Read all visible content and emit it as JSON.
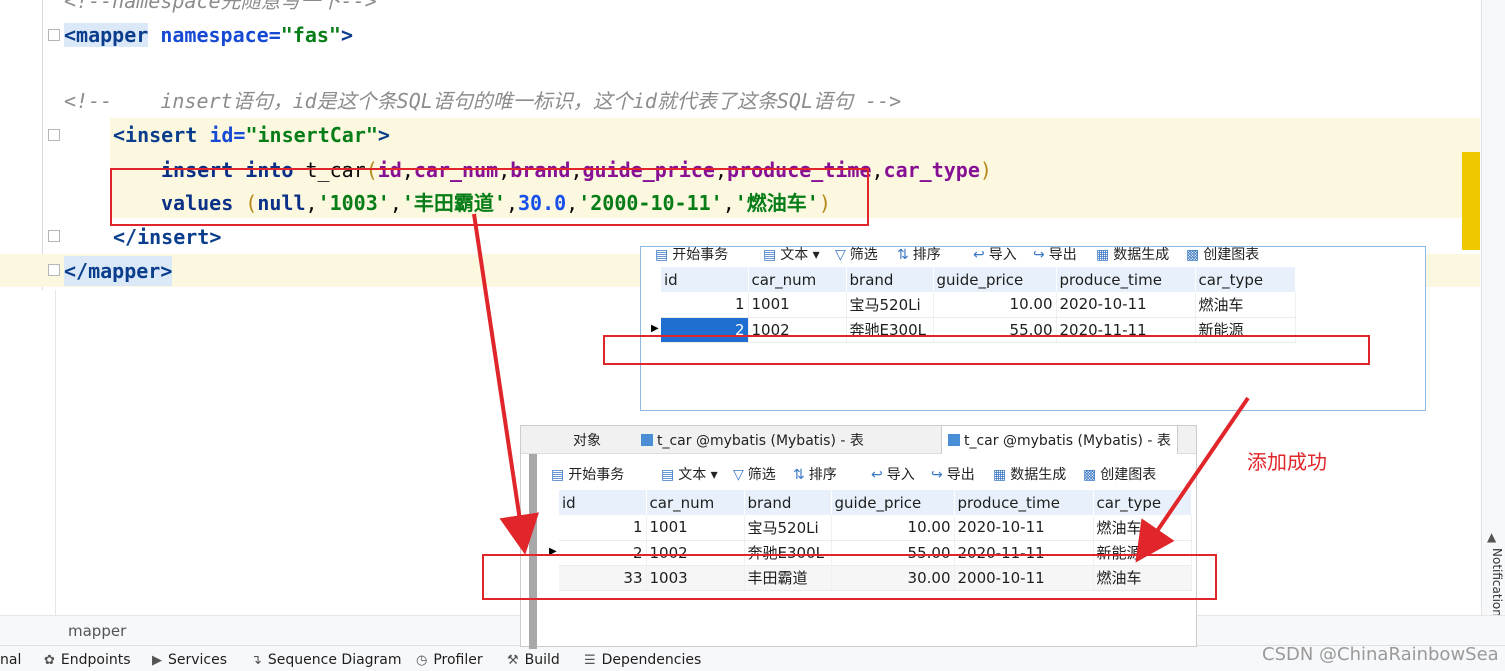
{
  "editor": {
    "lines": {
      "top_comment": "<!--namespace先随意写一下-->",
      "mapper_open_tag": "<mapper",
      "mapper_attr": "namespace=",
      "mapper_attr_value": "\"fas\"",
      "mapper_close_bracket": ">",
      "comment": "<!--    insert语句，id是这个条SQL语句的唯一标识，这个id就代表了这条SQL语句 -->",
      "insert_open": "<insert",
      "insert_attr": "id=",
      "insert_attr_value": "\"insertCar\"",
      "insert_bracket": ">",
      "sql_kw": "insert into",
      "sql_table": " t_car",
      "sql_cols": [
        "id",
        "car_num",
        "brand",
        "guide_price",
        "produce_time",
        "car_type"
      ],
      "values_kw": "values",
      "values_null": "null",
      "values_strs": [
        "'1003'",
        "'丰田霸道'"
      ],
      "values_num": "30.0",
      "values_strs2": [
        "'2000-10-11'",
        "'燃油车'"
      ],
      "insert_close": "</insert>",
      "mapper_close": "</mapper>"
    }
  },
  "breadcrumb": "mapper",
  "bottom_tools": [
    "nal",
    "Endpoints",
    "Services",
    "Sequence Diagram",
    "Profiler",
    "Build",
    "Dependencies"
  ],
  "notifications_label": "Notifications",
  "watermark": "CSDN @ChinaRainbowSea",
  "annotation_text": "添加成功",
  "panel_before": {
    "toolbar": [
      "开始事务",
      "文本",
      "筛选",
      "排序",
      "导入",
      "导出",
      "数据生成",
      "创建图表"
    ],
    "columns": [
      "id",
      "car_num",
      "brand",
      "guide_price",
      "produce_time",
      "car_type"
    ],
    "rows": [
      [
        "1",
        "1001",
        "宝马520Li",
        "10.00",
        "2020-10-11",
        "燃油车"
      ],
      [
        "2",
        "1002",
        "奔驰E300L",
        "55.00",
        "2020-11-11",
        "新能源"
      ]
    ]
  },
  "panel_after": {
    "tabs": [
      "对象",
      "t_car @mybatis (Mybatis) - 表",
      "t_car @mybatis (Mybatis) - 表"
    ],
    "toolbar": [
      "开始事务",
      "文本",
      "筛选",
      "排序",
      "导入",
      "导出",
      "数据生成",
      "创建图表"
    ],
    "columns": [
      "id",
      "car_num",
      "brand",
      "guide_price",
      "produce_time",
      "car_type"
    ],
    "rows": [
      [
        "1",
        "1001",
        "宝马520Li",
        "10.00",
        "2020-10-11",
        "燃油车"
      ],
      [
        "2",
        "1002",
        "奔驰E300L",
        "55.00",
        "2020-11-11",
        "新能源"
      ],
      [
        "33",
        "1003",
        "丰田霸道",
        "30.00",
        "2000-10-11",
        "燃油车"
      ]
    ]
  },
  "colors": {
    "annotation_red": "#e0262b",
    "highlight": "#fcf7df",
    "selection": "#1f6fd0",
    "scroll_marker": "#f0c800"
  }
}
